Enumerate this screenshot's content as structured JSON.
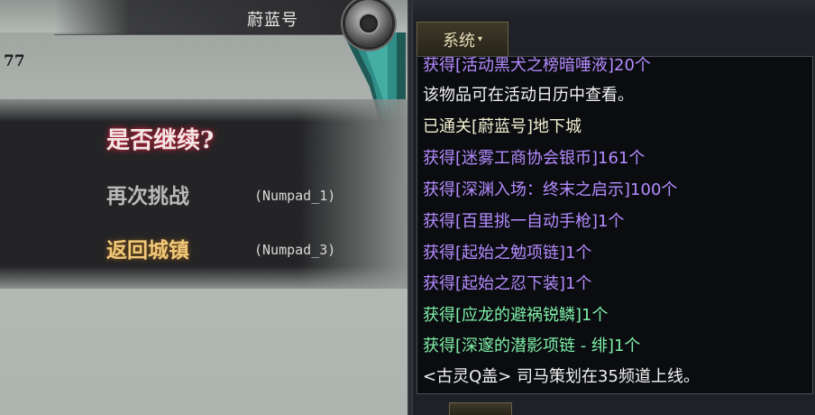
{
  "scene": {
    "dungeon_name": "蔚蓝号",
    "score": "77",
    "dialog": {
      "question": "是否继续?",
      "options": [
        {
          "label": "再次挑战",
          "key": "(Numpad_1)"
        },
        {
          "label": "返回城镇",
          "key": "(Numpad_3)"
        }
      ]
    }
  },
  "chat": {
    "tab_label": "系统",
    "caret": "▾",
    "lines": [
      {
        "text": "获得[活动黑犬之榜暗唾液]20个",
        "color": "#b58bff"
      },
      {
        "text": "该物品可在活动日历中查看。",
        "color": "#f2f2f2"
      },
      {
        "text": "已通关[蔚蓝号]地下城",
        "color": "#f3f0d2"
      },
      {
        "text": "获得[迷雾工商协会银币]161个",
        "color": "#b58bff"
      },
      {
        "text": "获得[深渊入场：终末之启示]100个",
        "color": "#b58bff"
      },
      {
        "text": "获得[百里挑一自动手枪]1个",
        "color": "#b58bff"
      },
      {
        "text": "获得[起始之勉项链]1个",
        "color": "#b58bff"
      },
      {
        "text": "获得[起始之忍下装]1个",
        "color": "#b58bff"
      },
      {
        "text": "获得[应龙的避祸锐鳞]1个",
        "color": "#7ff0a8"
      },
      {
        "text": "获得[深邃的潜影项链 - 绯]1个",
        "color": "#7ff0a8"
      },
      {
        "text": "<古灵Q盖> 司马策划在35频道上线。",
        "color": "#f2f2f2"
      }
    ]
  }
}
